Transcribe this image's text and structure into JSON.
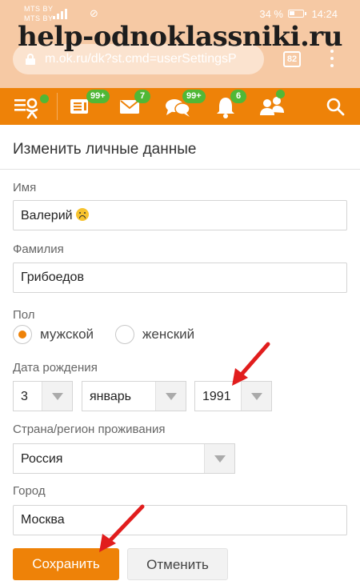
{
  "watermark": "help-odnoklassniki.ru",
  "status_bar": {
    "carrier_1": "MTS BY",
    "carrier_2": "MTS BY",
    "battery": "34 %",
    "time": "14:24"
  },
  "browser": {
    "url": "m.ok.ru/dk?st.cmd=userSettingsP",
    "tabs_count": "82"
  },
  "toolbar": {
    "items": [
      {
        "icon": "ok-logo-icon"
      },
      {
        "icon": "feed-icon",
        "badge": "99+"
      },
      {
        "icon": "messages-icon",
        "badge": "7"
      },
      {
        "icon": "discussions-icon",
        "badge": "99+"
      },
      {
        "icon": "notifications-icon",
        "badge": "6"
      },
      {
        "icon": "friends-icon"
      },
      {
        "icon": "search-icon"
      }
    ]
  },
  "form": {
    "title": "Изменить личные данные",
    "first_name_label": "Имя",
    "first_name_value": "Валерий",
    "last_name_label": "Фамилия",
    "last_name_value": "Грибоедов",
    "gender_label": "Пол",
    "gender_male": "мужской",
    "gender_female": "женский",
    "gender_selected": "мужской",
    "birthdate_label": "Дата рождения",
    "birth_day": "3",
    "birth_month": "январь",
    "birth_year": "1991",
    "country_label": "Страна/регион проживания",
    "country_value": "Россия",
    "city_label": "Город",
    "city_value": "Москва",
    "save_button": "Сохранить",
    "cancel_button": "Отменить"
  },
  "colors": {
    "accent": "#ee8208",
    "badge": "#50b836",
    "annotation_arrow": "#e11d1d"
  }
}
